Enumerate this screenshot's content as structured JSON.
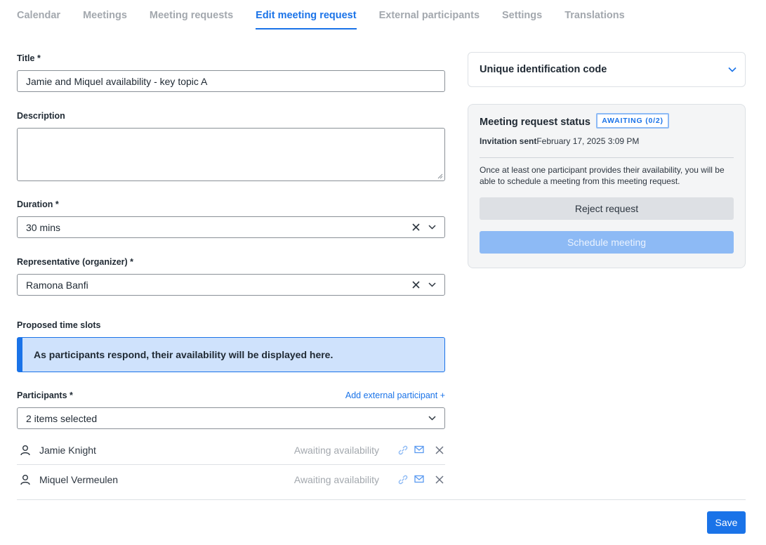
{
  "tabs": [
    {
      "label": "Calendar"
    },
    {
      "label": "Meetings"
    },
    {
      "label": "Meeting requests"
    },
    {
      "label": "Edit meeting request",
      "active": true
    },
    {
      "label": "External participants"
    },
    {
      "label": "Settings"
    },
    {
      "label": "Translations"
    }
  ],
  "form": {
    "title_label": "Title *",
    "title_value": "Jamie and Miquel availability - key topic A",
    "description_label": "Description",
    "description_value": "",
    "duration_label": "Duration *",
    "duration_value": "30 mins",
    "representative_label": "Representative (organizer) *",
    "representative_value": "Ramona Banfi",
    "timeslots_label": "Proposed time slots",
    "timeslots_info": "As participants respond, their availability will be displayed here.",
    "participants_label": "Participants *",
    "add_external_link": "Add external participant +",
    "participants_select_value": "2 items selected",
    "participants": [
      {
        "name": "Jamie Knight",
        "status": "Awaiting availability"
      },
      {
        "name": "Miquel Vermeulen",
        "status": "Awaiting availability"
      }
    ],
    "save_label": "Save"
  },
  "uid_panel": {
    "title": "Unique identification code"
  },
  "status_panel": {
    "title": "Meeting request status",
    "badge": "AWAITING (0/2)",
    "sent_label": "Invitation sent",
    "sent_value": "February 17, 2025 3:09 PM",
    "note": "Once at least one participant provides their availability, you will be able to schedule a meeting from this meeting request.",
    "reject_label": "Reject request",
    "schedule_label": "Schedule meeting"
  },
  "colors": {
    "accent": "#1a73e8",
    "info_bg": "#cfe2fc",
    "disabled_button": "#8dbaf5"
  },
  "icons": {
    "clear": "close-icon",
    "dropdown": "chevron-down-icon",
    "participant": "user-icon",
    "link": "link-icon",
    "mail": "mail-icon",
    "remove": "close-icon"
  }
}
